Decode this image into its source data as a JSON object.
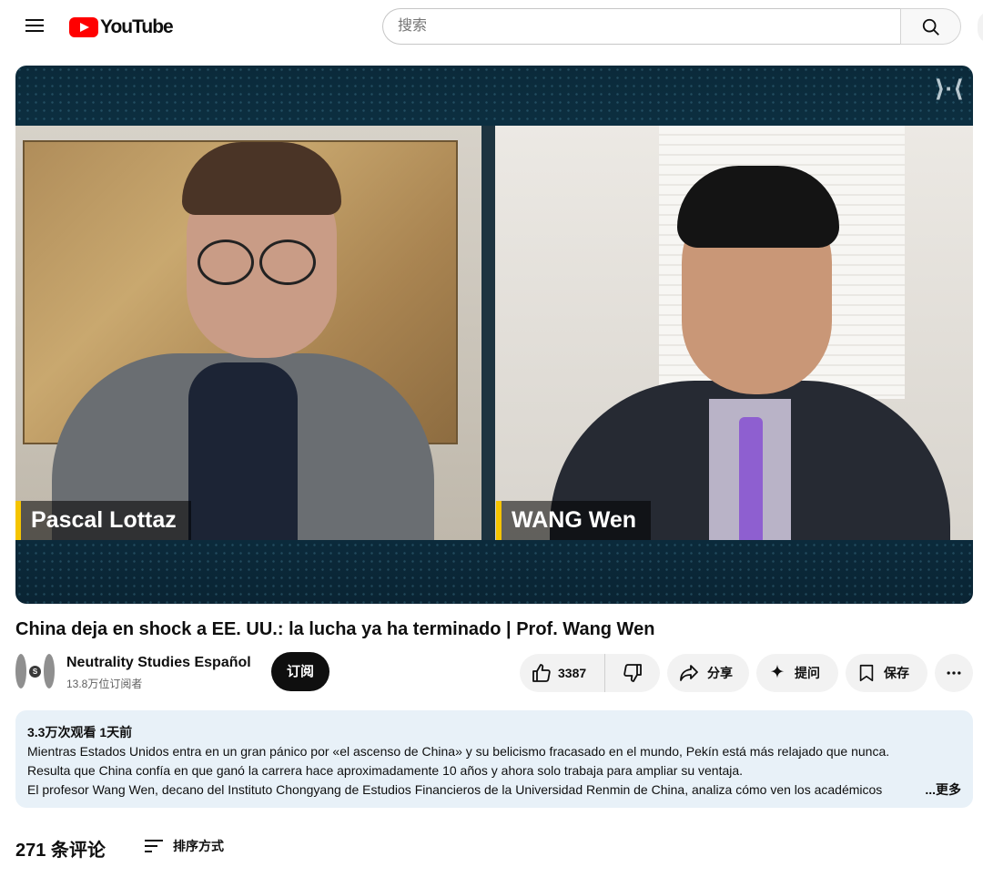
{
  "header": {
    "logo_text": "YouTube",
    "search_placeholder": "搜索",
    "brand_color": "#ff0000"
  },
  "icons": {
    "menu": "hamburger-menu-icon",
    "search": "search-icon",
    "like": "thumbs-up-icon",
    "dislike": "thumbs-down-icon",
    "share": "share-arrow-icon",
    "ask": "sparkle-icon",
    "save": "bookmark-icon",
    "more": "more-horizontal-icon",
    "sort": "sort-lines-icon"
  },
  "video": {
    "left_name": "Pascal Lottaz",
    "right_name": "WANG Wen",
    "watermark": "⟩·⟨",
    "nameplate_accent": "#f5c400"
  },
  "title": "China deja en shock a EE. UU.: la lucha ya ha terminado | Prof. Wang Wen",
  "channel": {
    "name": "Neutrality Studies Español",
    "subscribers": "13.8万位订阅者",
    "avatar_letter": "S",
    "subscribe_label": "订阅"
  },
  "actions": {
    "like_count": "3387",
    "share_label": "分享",
    "ask_label": "提问",
    "save_label": "保存"
  },
  "description": {
    "meta": "3.3万次观看  1天前",
    "line1": "Mientras Estados Unidos entra en un gran pánico por «el ascenso de China» y su belicismo fracasado en el mundo, Pekín está más relajado que nunca.",
    "line2": "Resulta que China confía en que ganó la carrera hace aproximadamente 10 años y ahora solo trabaja para ampliar su ventaja.",
    "line3": "El profesor Wang Wen, decano del Instituto Chongyang de Estudios Financieros de la Universidad Renmin de China, analiza cómo ven los académicos",
    "more_label": "...更多"
  },
  "comments": {
    "count_label": "271 条评论",
    "sort_label": "排序方式"
  }
}
